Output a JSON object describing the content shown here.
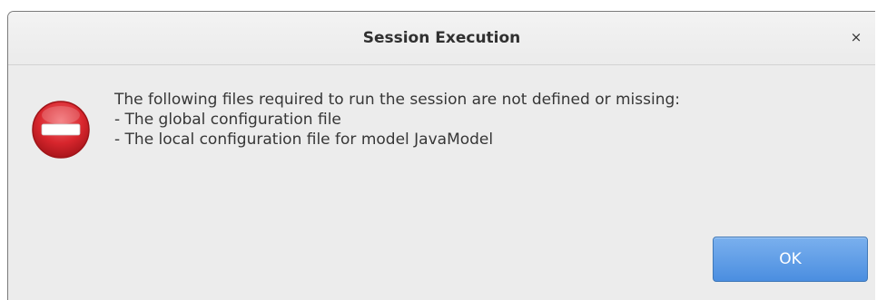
{
  "dialog": {
    "title": "Session Execution",
    "close_label": "×",
    "icon": "error-icon",
    "message_lines": [
      "The following files required to run the session are not defined or missing:",
      "- The global configuration file",
      "- The local configuration file for model JavaModel"
    ],
    "ok_label": "OK"
  },
  "colors": {
    "dialog_background": "#ececec",
    "button_accent": "#4b8ee0",
    "error_red": "#d8262d"
  }
}
